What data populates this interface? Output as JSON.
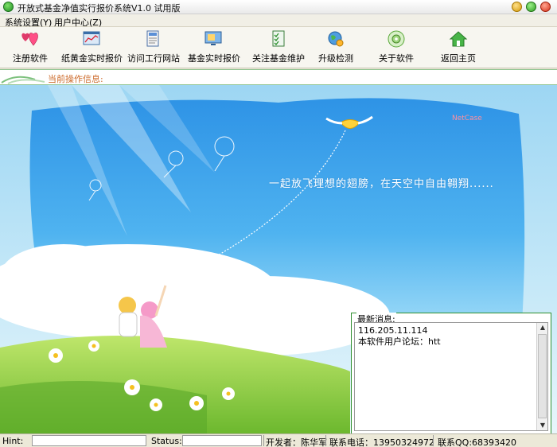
{
  "window": {
    "title": "开放式基金净值实行报价系统V1.0  试用版"
  },
  "menu": {
    "items": [
      {
        "label": "系统设置(Y)"
      },
      {
        "label": "用户中心(Z)"
      }
    ]
  },
  "toolbar": {
    "items": [
      {
        "label": "注册软件",
        "icon": "hearts-icon"
      },
      {
        "label": "纸黄金实时报价",
        "icon": "chart-window-icon"
      },
      {
        "label": "访问工行网站",
        "icon": "document-icon"
      },
      {
        "label": "基金实时报价",
        "icon": "monitor-icon"
      },
      {
        "label": "关注基金维护",
        "icon": "checklist-icon"
      },
      {
        "label": "升级检测",
        "icon": "globe-update-icon"
      },
      {
        "label": "关于软件",
        "icon": "disc-icon"
      },
      {
        "label": "返回主页",
        "icon": "home-icon"
      }
    ]
  },
  "info": {
    "label": "当前操作信息:"
  },
  "scene": {
    "slogan": "一起放飞理想的翅膀，在天空中自由翱翔......",
    "logo": "NetCase"
  },
  "news": {
    "title": "最新消息:",
    "lines": [
      "116.205.11.114",
      "本软件用户论坛：htt"
    ]
  },
  "status": {
    "hint_label": "Hint:",
    "status_label": "Status:",
    "developer": "开发者：陈华军",
    "phone": "联系电话：13950324972",
    "qq": "联系QQ:68393420"
  },
  "colors": {
    "accent_green": "#2f8f2f",
    "sky": "#3a9be0"
  }
}
